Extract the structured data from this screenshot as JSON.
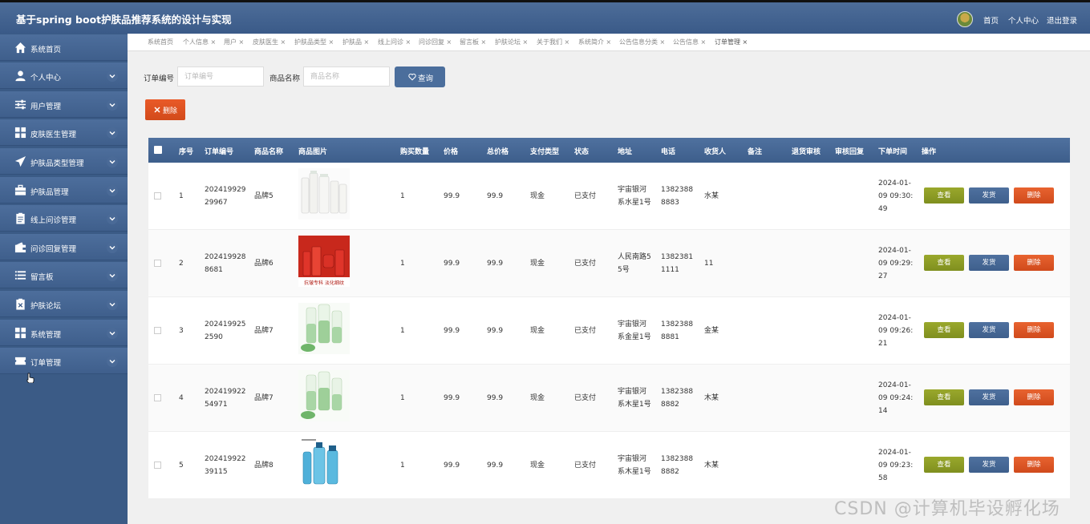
{
  "app": {
    "title": "基于spring boot护肤品推荐系统的设计与实现"
  },
  "topnav": {
    "home": "首页",
    "profile": "个人中心",
    "logout": "退出登录"
  },
  "sidebar": {
    "items": [
      {
        "label": "系统首页",
        "icon": "home-icon"
      },
      {
        "label": "个人中心",
        "icon": "user-icon"
      },
      {
        "label": "用户管理",
        "icon": "sliders-icon"
      },
      {
        "label": "皮肤医生管理",
        "icon": "grid-icon"
      },
      {
        "label": "护肤品类型管理",
        "icon": "send-icon"
      },
      {
        "label": "护肤品管理",
        "icon": "briefcase-icon"
      },
      {
        "label": "线上问诊管理",
        "icon": "clipboard-icon"
      },
      {
        "label": "问诊回复管理",
        "icon": "wallet-icon"
      },
      {
        "label": "留言板",
        "icon": "list-icon"
      },
      {
        "label": "护肤论坛",
        "icon": "clipboard-x-icon"
      },
      {
        "label": "系统管理",
        "icon": "grid-icon"
      },
      {
        "label": "订单管理",
        "icon": "ticket-icon"
      }
    ]
  },
  "tabs": [
    {
      "label": "系统首页"
    },
    {
      "label": "个人信息 ×"
    },
    {
      "label": "用户 ×"
    },
    {
      "label": "皮肤医生 ×"
    },
    {
      "label": "护肤品类型 ×"
    },
    {
      "label": "护肤品 ×"
    },
    {
      "label": "线上问诊 ×"
    },
    {
      "label": "问诊回复 ×"
    },
    {
      "label": "留言板 ×"
    },
    {
      "label": "护肤论坛 ×"
    },
    {
      "label": "关于我们 ×"
    },
    {
      "label": "系统简介 ×"
    },
    {
      "label": "公告信息分类 ×"
    },
    {
      "label": "公告信息 ×"
    },
    {
      "label": "订单管理 ×"
    }
  ],
  "search": {
    "order_label": "订单编号",
    "order_placeholder": "订单编号",
    "product_label": "商品名称",
    "product_placeholder": "商品名称",
    "query_label": "查询",
    "delete_label": "删除"
  },
  "table": {
    "headers": [
      "序号",
      "订单编号",
      "商品名称",
      "商品图片",
      "购买数量",
      "价格",
      "总价格",
      "支付类型",
      "状态",
      "地址",
      "电话",
      "收货人",
      "备注",
      "退货审核",
      "审核回复",
      "下单时间",
      "操作"
    ],
    "actions": {
      "view": "查看",
      "ship": "发货",
      "delete": "删除"
    },
    "rows": [
      {
        "no": "1",
        "order_l1": "202419929",
        "order_l2": "29967",
        "product": "品牌5",
        "qty": "1",
        "price": "99.9",
        "total": "99.9",
        "pay": "现金",
        "status": "已支付",
        "addr_l1": "宇宙银河",
        "addr_l2": "系水星1号",
        "phone_l1": "1382388",
        "phone_l2": "8883",
        "receiver": "水某",
        "note": "",
        "return_audit": "",
        "audit_reply": "",
        "time_l1": "2024-01-",
        "time_l2": "09 09:30:",
        "time_l3": "49",
        "image": "white-bottles"
      },
      {
        "no": "2",
        "order_l1": "202419928",
        "order_l2": "8681",
        "product": "品牌6",
        "qty": "1",
        "price": "99.9",
        "total": "99.9",
        "pay": "现金",
        "status": "已支付",
        "addr_l1": "人民南路5",
        "addr_l2": "5号",
        "phone_l1": "1382381",
        "phone_l2": "1111",
        "receiver": "11",
        "note": "",
        "return_audit": "",
        "audit_reply": "",
        "time_l1": "2024-01-",
        "time_l2": "09 09:29:",
        "time_l3": "27",
        "image": "red-set",
        "image_caption": "抗皱专科 淡化细纹"
      },
      {
        "no": "3",
        "order_l1": "202419925",
        "order_l2": "2590",
        "product": "品牌7",
        "qty": "1",
        "price": "99.9",
        "total": "99.9",
        "pay": "现金",
        "status": "已支付",
        "addr_l1": "宇宙银河",
        "addr_l2": "系金星1号",
        "phone_l1": "1382388",
        "phone_l2": "8881",
        "receiver": "金某",
        "note": "",
        "return_audit": "",
        "audit_reply": "",
        "time_l1": "2024-01-",
        "time_l2": "09 09:26:",
        "time_l3": "21",
        "image": "green-bottles"
      },
      {
        "no": "4",
        "order_l1": "202419922",
        "order_l2": "54971",
        "product": "品牌7",
        "qty": "1",
        "price": "99.9",
        "total": "99.9",
        "pay": "现金",
        "status": "已支付",
        "addr_l1": "宇宙银河",
        "addr_l2": "系木星1号",
        "phone_l1": "1382388",
        "phone_l2": "8882",
        "receiver": "木某",
        "note": "",
        "return_audit": "",
        "audit_reply": "",
        "time_l1": "2024-01-",
        "time_l2": "09 09:24:",
        "time_l3": "14",
        "image": "green-bottles"
      },
      {
        "no": "5",
        "order_l1": "202419922",
        "order_l2": "39115",
        "product": "品牌8",
        "qty": "1",
        "price": "99.9",
        "total": "99.9",
        "pay": "现金",
        "status": "已支付",
        "addr_l1": "宇宙银河",
        "addr_l2": "系木星1号",
        "phone_l1": "1382388",
        "phone_l2": "8882",
        "receiver": "木某",
        "note": "",
        "return_audit": "",
        "audit_reply": "",
        "time_l1": "2024-01-",
        "time_l2": "09 09:23:",
        "time_l3": "58",
        "image": "blue-bottles"
      }
    ]
  },
  "watermark": "CSDN @计算机毕设孵化场",
  "colors": {
    "header": "#3d5e8b",
    "view": "#8a9a22",
    "ship": "#4a6b98",
    "delete": "#d9501f"
  }
}
